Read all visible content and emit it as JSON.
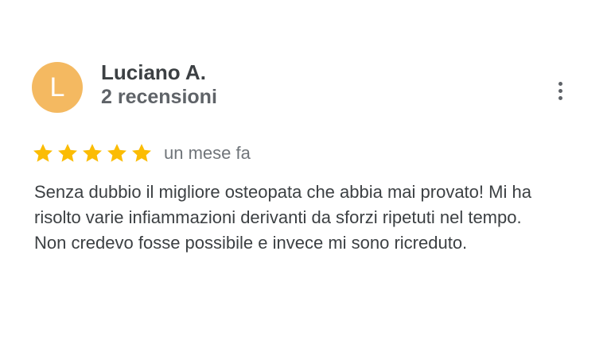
{
  "reviewer": {
    "initial": "L",
    "name": "Luciano A.",
    "reviews_count": "2 recensioni"
  },
  "review": {
    "rating": 5,
    "max_rating": 5,
    "date": "un mese fa",
    "text_lines": [
      "Senza dubbio il migliore osteopata che abbia mai provato! Mi ha",
      "risolto varie infiammazioni derivanti da sforzi ripetuti nel tempo.",
      "Non credevo fosse possibile e invece mi sono ricreduto."
    ]
  },
  "icons": {
    "star": "star-icon",
    "more": "more-vert-icon"
  },
  "colors": {
    "avatar_bg": "#f4b961",
    "star": "#fbbc04",
    "name_text": "#3c4043",
    "secondary_text": "#5f6368",
    "date_text": "#70757a"
  }
}
